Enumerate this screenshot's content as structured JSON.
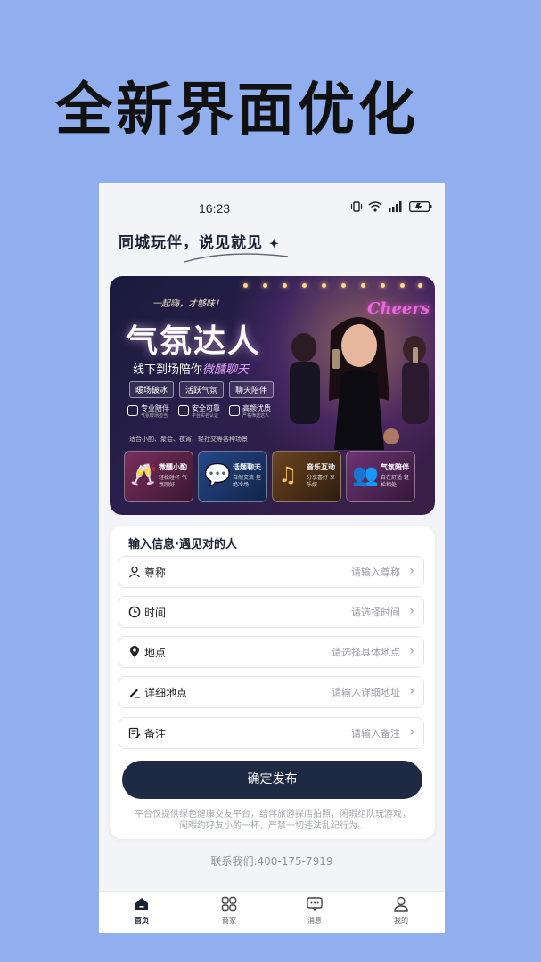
{
  "promo": {
    "headline": "全新界面优化"
  },
  "status_bar": {
    "time": "16:23"
  },
  "header": {
    "slogan": "同城玩伴，说见就见"
  },
  "banner": {
    "small_tag": "一起嗨，才够味！",
    "title": "气氛达人",
    "subtitle_prefix": "线下到场陪你",
    "subtitle_highlight": "微醺聊天",
    "neon_sign": "Cheers",
    "pills": [
      "暖场破冰",
      "活跃气氛",
      "聊天陪伴"
    ],
    "features": [
      {
        "title": "专业陪伴",
        "desc": "气氛暖场担当"
      },
      {
        "title": "安全可靠",
        "desc": "平台实名认证"
      },
      {
        "title": "高颜优质",
        "desc": "严格筛选达人"
      }
    ],
    "tagline": "适合小酌、聚会、夜宵、轻社交等各种场景",
    "cards": [
      {
        "title": "微醺小酌",
        "desc": "轻松碰杯 气氛刚好",
        "icon": "cheers-icon",
        "color": "#6b2a52"
      },
      {
        "title": "话题聊天",
        "desc": "自然交流 拒绝冷场",
        "icon": "chat-icon",
        "color": "#1f3c74"
      },
      {
        "title": "音乐互动",
        "desc": "分享喜好 享乐娱",
        "icon": "music-icon",
        "color": "#5a3a1c"
      },
      {
        "title": "气氛陪伴",
        "desc": "自在舒适 轻松相处",
        "icon": "people-icon",
        "color": "#5b2f62"
      }
    ]
  },
  "form": {
    "title": "输入信息·遇见对的人",
    "fields": [
      {
        "label": "尊称",
        "placeholder": "请输入尊称",
        "icon": "user-icon"
      },
      {
        "label": "时间",
        "placeholder": "请选择时间",
        "icon": "clock-icon"
      },
      {
        "label": "地点",
        "placeholder": "请选择具体地点",
        "icon": "location-pin-icon"
      },
      {
        "label": "详细地点",
        "placeholder": "请输入详细地址",
        "icon": "pen-icon"
      },
      {
        "label": "备注",
        "placeholder": "请输入备注",
        "icon": "note-edit-icon"
      }
    ],
    "submit_label": "确定发布",
    "disclaimer": "平台仅提供绿色健康交友平台，结伴旅游探店拍照，闲暇组队玩游戏，闲暇约好友小酌一杯，严禁一切违法乱纪行为。"
  },
  "contact": "联系我们:400-175-7919",
  "tabbar": [
    {
      "label": "首页",
      "icon": "home-icon",
      "active": true
    },
    {
      "label": "商家",
      "icon": "grid-icon",
      "active": false
    },
    {
      "label": "消息",
      "icon": "message-icon",
      "active": false
    },
    {
      "label": "我的",
      "icon": "profile-icon",
      "active": false
    }
  ],
  "colors": {
    "background": "#91afef",
    "primary": "#1e2a44",
    "banner": "#1f1c40"
  }
}
